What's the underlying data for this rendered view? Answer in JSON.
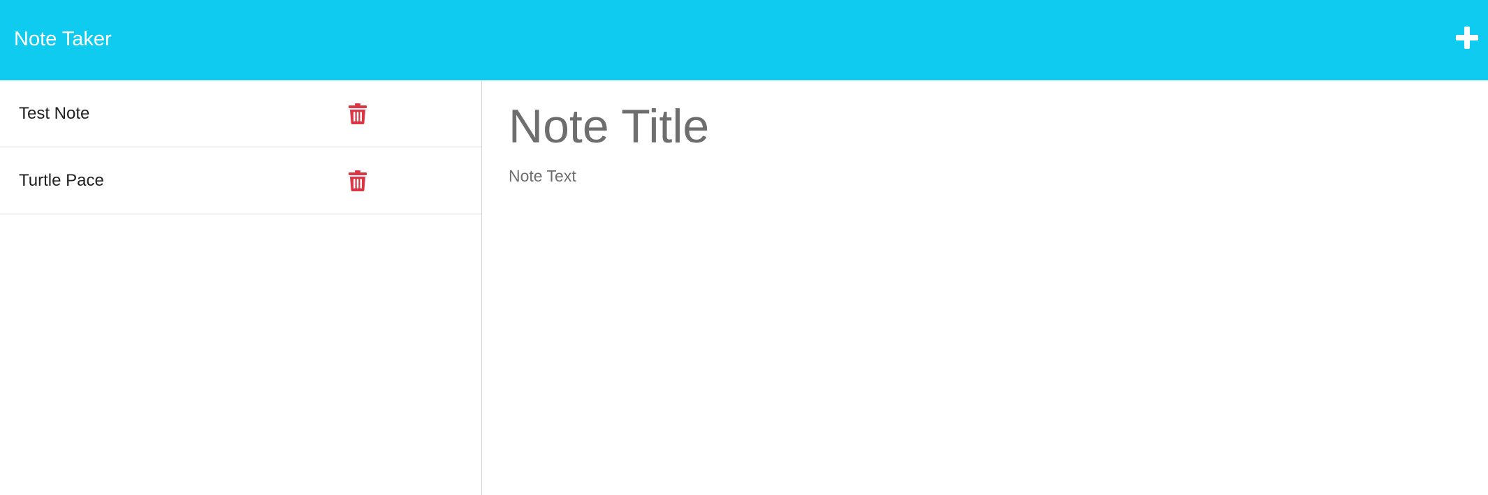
{
  "navbar": {
    "title": "Note Taker",
    "background_color": "#10cbf0",
    "new_note_icon": "plus-icon"
  },
  "sidebar": {
    "notes": [
      {
        "title": "Test Note",
        "delete_icon": "trash-icon"
      },
      {
        "title": "Turtle Pace",
        "delete_icon": "trash-icon"
      }
    ],
    "delete_icon_color": "#dc3545"
  },
  "editor": {
    "title_placeholder": "Note Title",
    "text_placeholder": "Note Text"
  }
}
